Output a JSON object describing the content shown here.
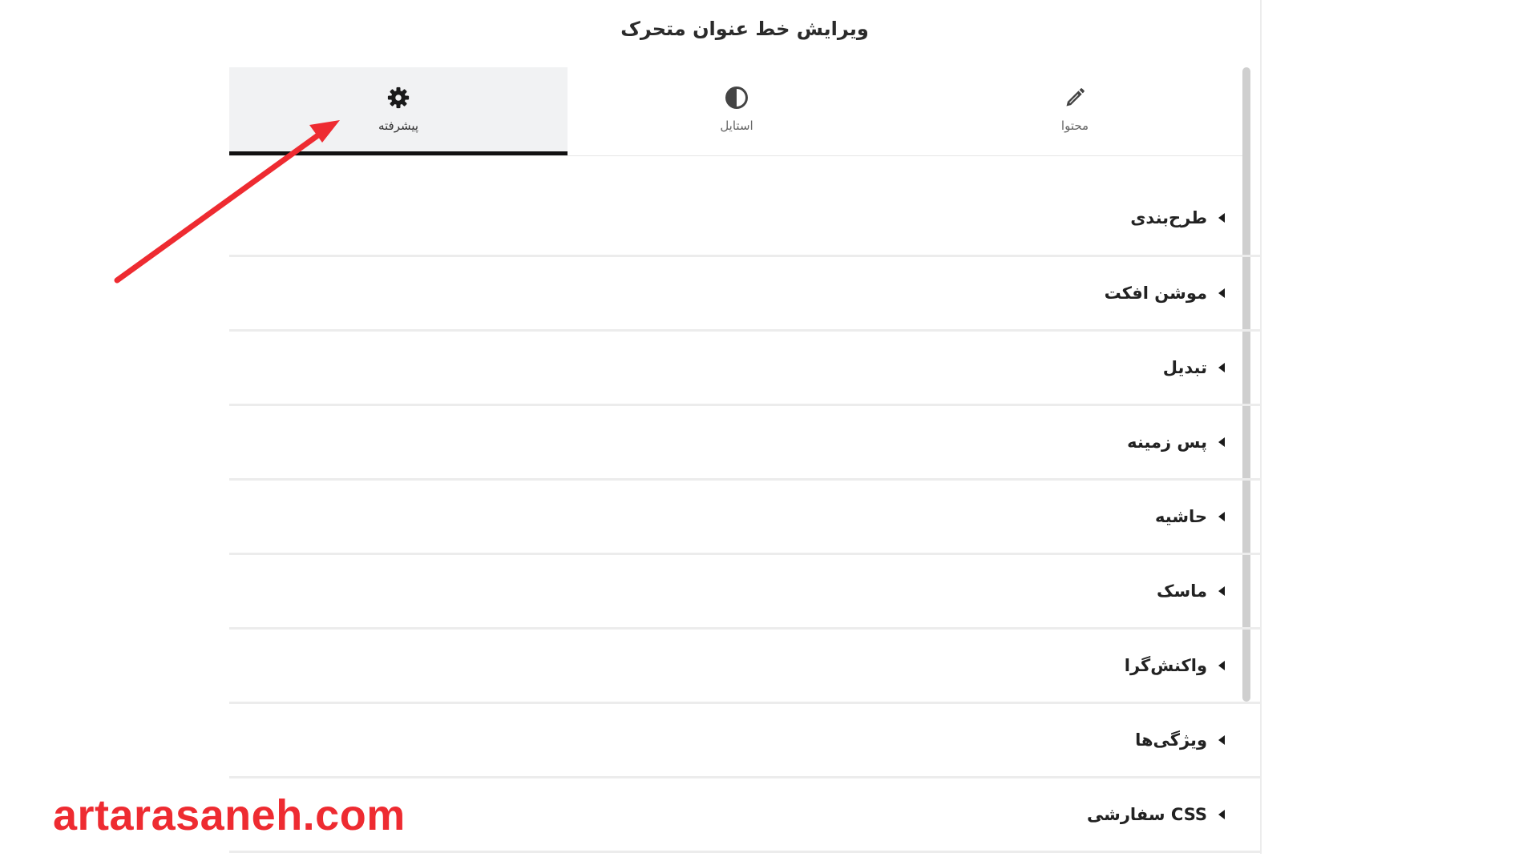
{
  "panel": {
    "title": "ویرایش خط عنوان متحرک"
  },
  "tabs": [
    {
      "label": "محتوا",
      "icon": "pencil-icon",
      "active": false
    },
    {
      "label": "استایل",
      "icon": "contrast-icon",
      "active": false
    },
    {
      "label": "پیشرفته",
      "icon": "gear-icon",
      "active": true
    }
  ],
  "sections": [
    {
      "label": "طرح‌بندی"
    },
    {
      "label": "موشن افکت"
    },
    {
      "label": "تبدیل"
    },
    {
      "label": "پس زمینه"
    },
    {
      "label": "حاشیه"
    },
    {
      "label": "ماسک"
    },
    {
      "label": "واکنش‌گرا"
    },
    {
      "label": "ویژگی‌ها"
    },
    {
      "label": "CSS سفارشی"
    }
  ],
  "annotation": {
    "arrow_color": "#ee2b31"
  },
  "watermark": {
    "text": "artarasaneh.com",
    "color": "#ee2b31"
  },
  "colors": {
    "active_tab_bg": "#f1f2f3",
    "active_tab_underline": "#111111",
    "divider": "#ececec"
  }
}
